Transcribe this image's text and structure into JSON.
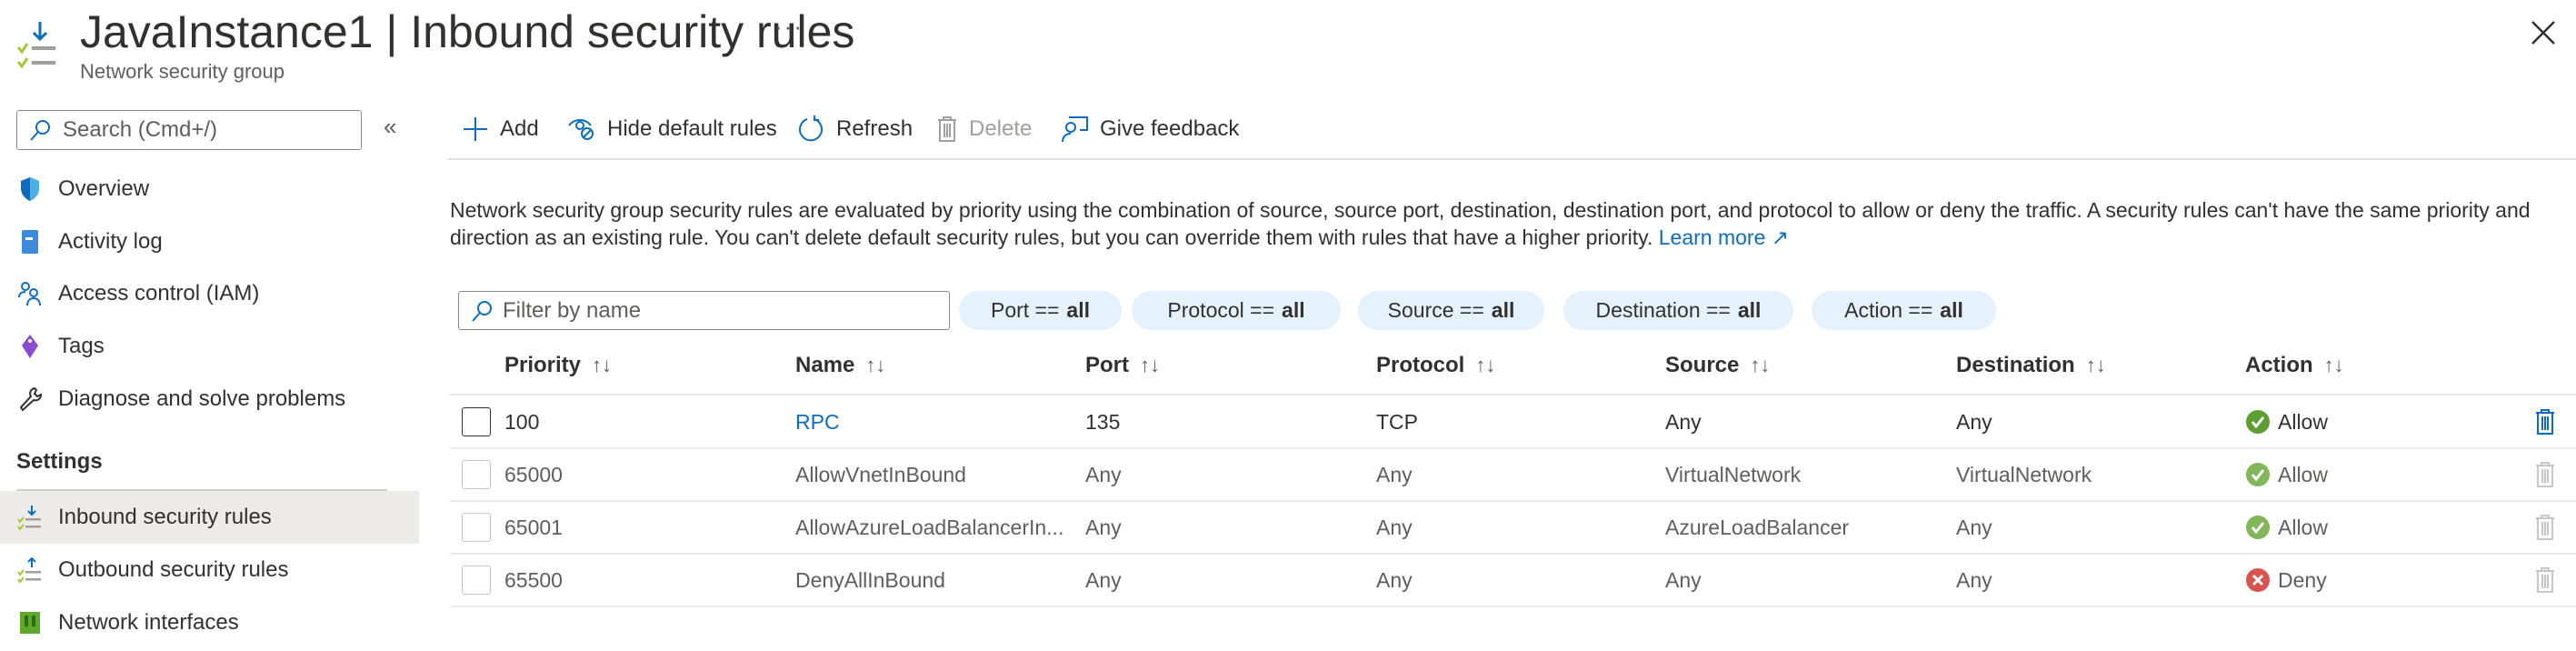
{
  "header": {
    "resource_name": "JavaInstance1",
    "separator": " | ",
    "page_title": "Inbound security rules",
    "resource_type": "Network security group",
    "more": "···"
  },
  "sidebar": {
    "search_placeholder": "Search (Cmd+/)",
    "collapse": "«",
    "items": [
      {
        "label": "Overview",
        "icon": "shield-icon"
      },
      {
        "label": "Activity log",
        "icon": "activity-log-icon"
      },
      {
        "label": "Access control (IAM)",
        "icon": "people-icon"
      },
      {
        "label": "Tags",
        "icon": "tag-icon"
      },
      {
        "label": "Diagnose and solve problems",
        "icon": "wrench-icon"
      }
    ],
    "section": "Settings",
    "settings_items": [
      {
        "label": "Inbound security rules",
        "icon": "inbound-rules-icon",
        "active": true
      },
      {
        "label": "Outbound security rules",
        "icon": "outbound-rules-icon"
      },
      {
        "label": "Network interfaces",
        "icon": "network-interface-icon"
      }
    ]
  },
  "toolbar": {
    "add": "Add",
    "hide_default": "Hide default rules",
    "refresh": "Refresh",
    "delete": "Delete",
    "feedback": "Give feedback"
  },
  "description": {
    "text": "Network security group security rules are evaluated by priority using the combination of source, source port, destination, destination port, and protocol to allow or deny the traffic. A security rules can't have the same priority and direction as an existing rule. You can't delete default security rules, but you can override them with rules that have a higher priority.",
    "learn_more": "Learn more"
  },
  "filters": {
    "placeholder": "Filter by name",
    "pills": [
      {
        "key": "Port ==",
        "value": "all"
      },
      {
        "key": "Protocol ==",
        "value": "all"
      },
      {
        "key": "Source ==",
        "value": "all"
      },
      {
        "key": "Destination ==",
        "value": "all"
      },
      {
        "key": "Action ==",
        "value": "all"
      }
    ]
  },
  "table": {
    "columns": [
      "Priority",
      "Name",
      "Port",
      "Protocol",
      "Source",
      "Destination",
      "Action"
    ],
    "sort_glyph": "↑↓",
    "rows": [
      {
        "priority": "100",
        "name": "RPC",
        "port": "135",
        "protocol": "TCP",
        "source": "Any",
        "destination": "Any",
        "action": "Allow",
        "default": false
      },
      {
        "priority": "65000",
        "name": "AllowVnetInBound",
        "port": "Any",
        "protocol": "Any",
        "source": "VirtualNetwork",
        "destination": "VirtualNetwork",
        "action": "Allow",
        "default": true
      },
      {
        "priority": "65001",
        "name": "AllowAzureLoadBalancerIn...",
        "port": "Any",
        "protocol": "Any",
        "source": "AzureLoadBalancer",
        "destination": "Any",
        "action": "Allow",
        "default": true
      },
      {
        "priority": "65500",
        "name": "DenyAllInBound",
        "port": "Any",
        "protocol": "Any",
        "source": "Any",
        "destination": "Any",
        "action": "Deny",
        "default": true
      }
    ]
  },
  "colors": {
    "accent": "#0f6cbd",
    "allow": "#5c9e31",
    "allow_default": "#82b65a",
    "deny": "#d9534f",
    "pill_bg": "#e5f1fb",
    "active_item": "#edebe9"
  }
}
